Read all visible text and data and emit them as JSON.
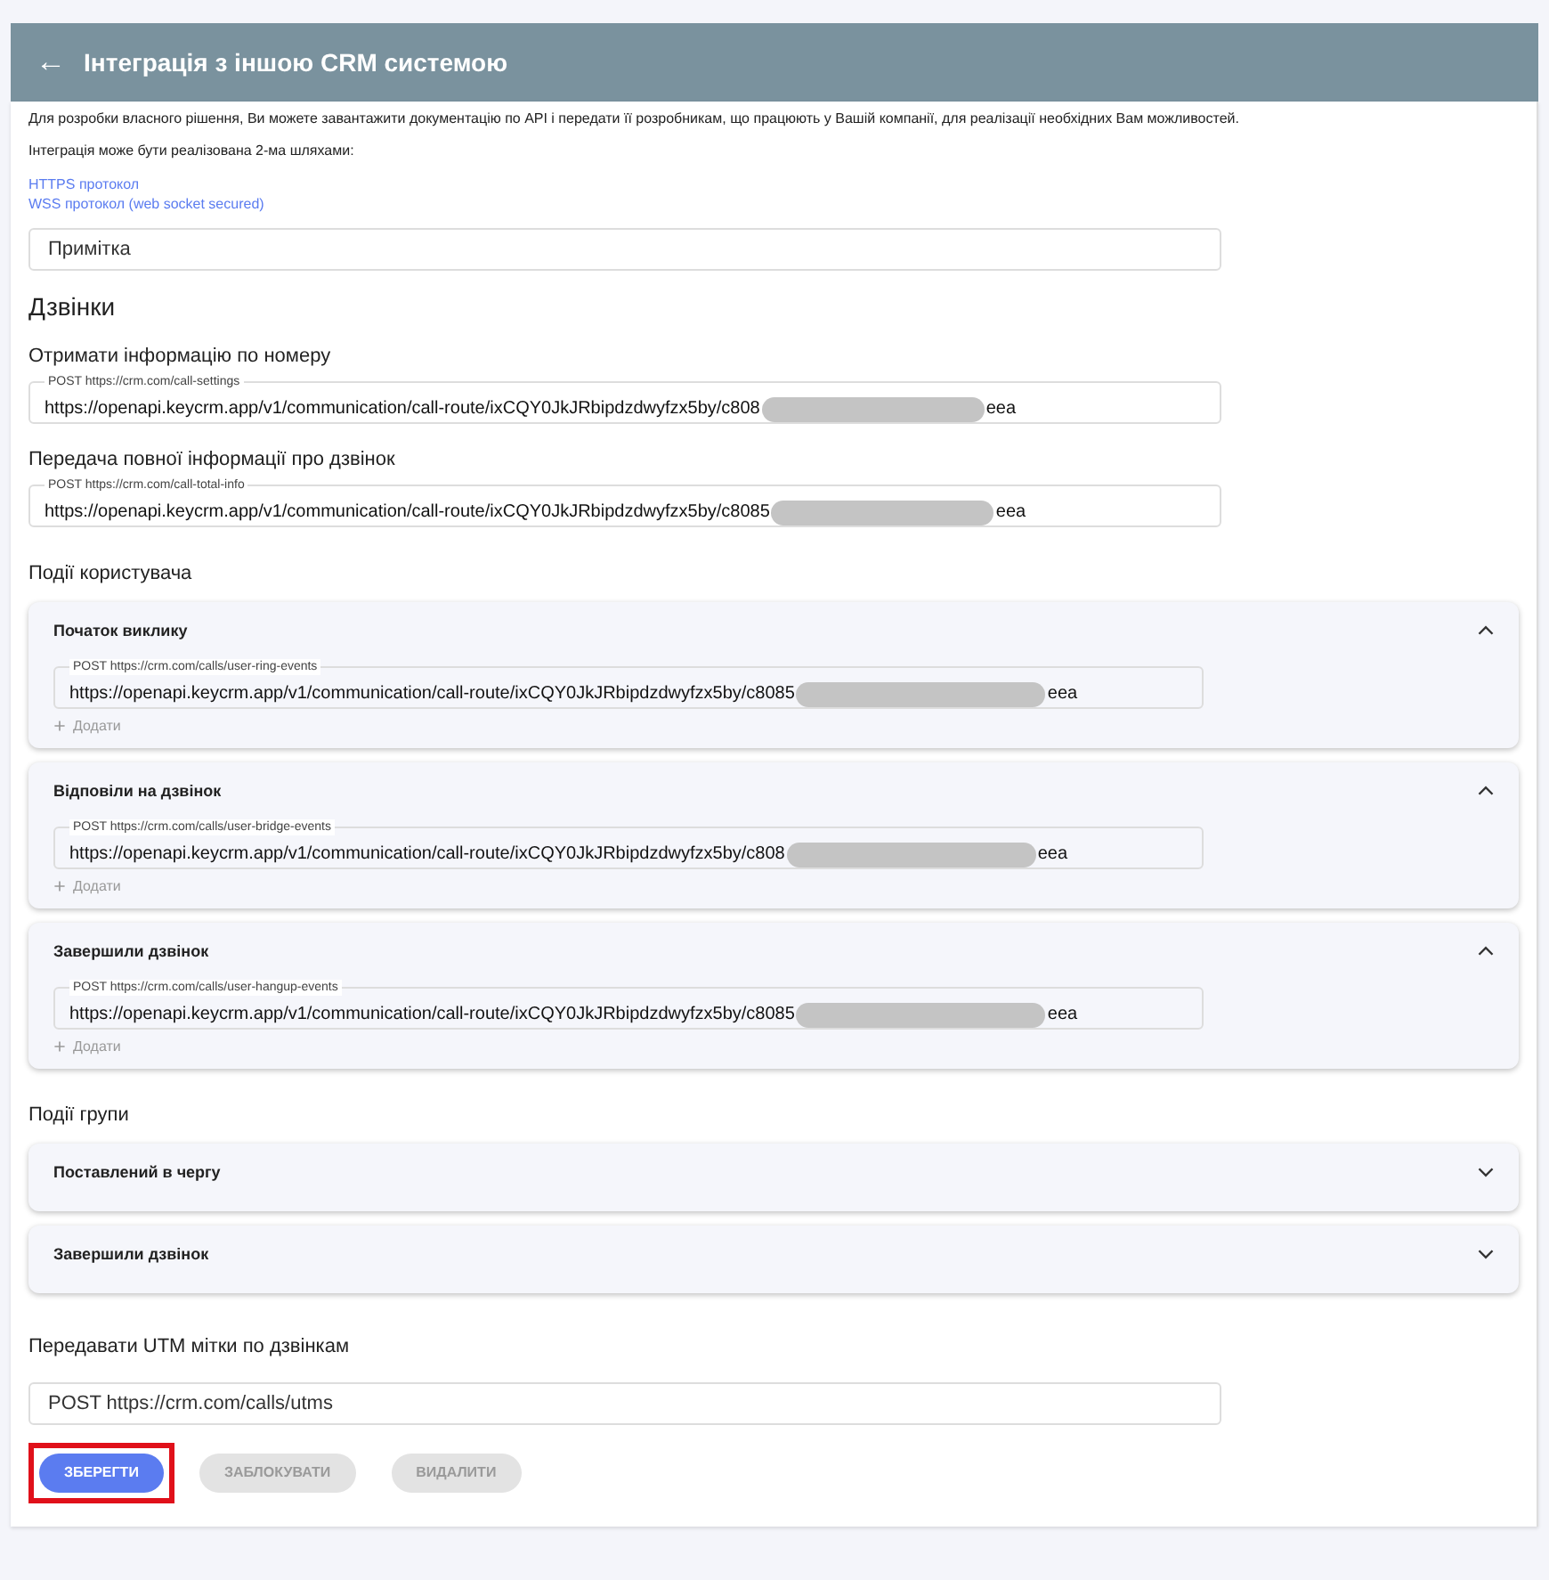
{
  "header": {
    "back_icon": "←",
    "title": "Інтеграція з іншою CRM системою"
  },
  "intro": [
    "Для розробки власного рішення, Ви можете завантажити документацію по API і передати її розробникам, що працюють у Вашій компанії, для реалізації необхідних Вам можливостей.",
    "Інтеграція може бути реалізована 2-ма шляхами:"
  ],
  "links": [
    "HTTPS протокол",
    "WSS протокол (web socket secured)"
  ],
  "note_field": {
    "placeholder": "Примітка"
  },
  "calls_heading": "Дзвінки",
  "call_fields": [
    {
      "title": "Отримати інформацію по номеру",
      "label": "POST https://crm.com/call-settings",
      "value_start": "https://openapi.keycrm.app/v1/communication/call-route/ixCQY0JkJRbipdzdwyfzx5by/c808",
      "value_end": "eea"
    },
    {
      "title": "Передача повної інформації про дзвінок",
      "label": "POST https://crm.com/call-total-info",
      "value_start": "https://openapi.keycrm.app/v1/communication/call-route/ixCQY0JkJRbipdzdwyfzx5by/c8085",
      "value_end": "eea"
    }
  ],
  "user_events_heading": "Події користувача",
  "user_events": [
    {
      "title": "Початок виклику",
      "expanded": true,
      "label": "POST https://crm.com/calls/user-ring-events",
      "value_start": "https://openapi.keycrm.app/v1/communication/call-route/ixCQY0JkJRbipdzdwyfzx5by/c8085",
      "value_end": "eea",
      "add": "Додати"
    },
    {
      "title": "Відповіли на дзвінок",
      "expanded": true,
      "label": "POST https://crm.com/calls/user-bridge-events",
      "value_start": "https://openapi.keycrm.app/v1/communication/call-route/ixCQY0JkJRbipdzdwyfzx5by/c808",
      "value_end": "eea",
      "add": "Додати"
    },
    {
      "title": "Завершили дзвінок",
      "expanded": true,
      "label": "POST https://crm.com/calls/user-hangup-events",
      "value_start": "https://openapi.keycrm.app/v1/communication/call-route/ixCQY0JkJRbipdzdwyfzx5by/c8085",
      "value_end": "eea",
      "add": "Додати"
    }
  ],
  "group_events_heading": "Події групи",
  "group_events": [
    {
      "title": "Поставлений в чергу",
      "expanded": false
    },
    {
      "title": "Завершили дзвінок",
      "expanded": false
    }
  ],
  "utm_heading": "Передавати UTM мітки по дзвінкам",
  "utm_field": {
    "value": "POST https://crm.com/calls/utms"
  },
  "buttons": [
    {
      "label": "ЗБЕРЕГТИ",
      "disabled": false,
      "highlighted": true
    },
    {
      "label": "ЗАБЛОКУВАТИ",
      "disabled": true,
      "highlighted": false
    },
    {
      "label": "ВИДАЛИТИ",
      "disabled": true,
      "highlighted": false
    }
  ]
}
